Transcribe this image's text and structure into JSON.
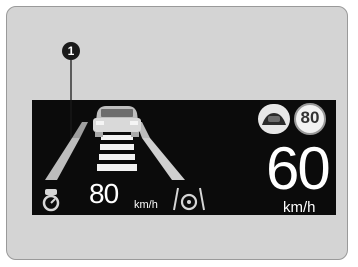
{
  "callout": {
    "number": "1"
  },
  "hud": {
    "set_speed": {
      "value": "80",
      "unit": "km/h"
    },
    "current_speed": {
      "value": "60",
      "unit": "km/h"
    },
    "speed_limit_sign": {
      "value": "80"
    }
  },
  "icons": {
    "car": "lead-car-icon",
    "road": "road-lane-icon",
    "distance": "following-distance-icon",
    "steering": "lane-keep-steering-icon",
    "pedal": "speed-limiter-icon",
    "tsr": "traffic-sign-recognition-icon"
  },
  "colors": {
    "hud_bg": "#0b0b0b",
    "frame_bg": "#d4d4d4",
    "lane": "#c9c9c9",
    "text": "#ffffff"
  }
}
